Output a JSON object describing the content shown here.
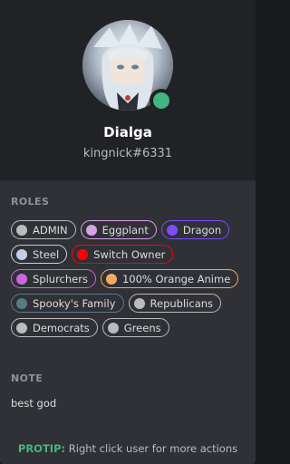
{
  "profile": {
    "username": "Dialga",
    "tag": "kingnick#6331",
    "status": "online",
    "status_color": "#43b581",
    "avatar_icon": "anime-character-avatar"
  },
  "sections": {
    "roles_title": "ROLES",
    "note_title": "NOTE"
  },
  "roles": [
    {
      "name": "ADMIN",
      "color": "#b9bbbe"
    },
    {
      "name": "Eggplant",
      "color": "#d6a2e8"
    },
    {
      "name": "Dragon",
      "color": "#7c4dff"
    },
    {
      "name": "Steel",
      "color": "#c8cde8"
    },
    {
      "name": "Switch Owner",
      "color": "#ff0000"
    },
    {
      "name": "Splurchers",
      "color": "#cc66e0"
    },
    {
      "name": "100% Orange Anime",
      "color": "#f5a962"
    },
    {
      "name": "Spooky's Family",
      "color": "#5a7a86"
    },
    {
      "name": "Republicans",
      "color": "#b9bbbe"
    },
    {
      "name": "Democrats",
      "color": "#b9bbbe"
    },
    {
      "name": "Greens",
      "color": "#b9bbbe"
    }
  ],
  "note": {
    "text": "best god"
  },
  "protip": {
    "label": "PROTIP:",
    "text": "Right click user for more actions"
  }
}
